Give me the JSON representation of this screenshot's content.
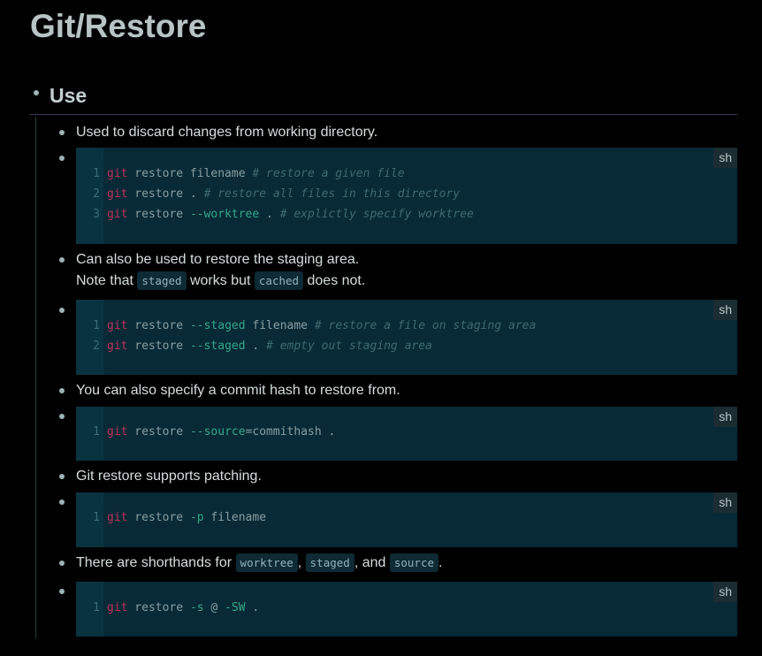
{
  "page_title": "Git/Restore",
  "section_title": "Use",
  "items": [
    {
      "text": "Used to discard changes from working directory."
    },
    {
      "lang": "sh",
      "lines": [
        {
          "n": "1",
          "parts": [
            [
              "kw",
              "git"
            ],
            [
              "tx",
              " restore filename "
            ],
            [
              "cm",
              "# restore a given file"
            ]
          ]
        },
        {
          "n": "2",
          "parts": [
            [
              "kw",
              "git"
            ],
            [
              "tx",
              " restore . "
            ],
            [
              "cm",
              "# restore all files in this directory"
            ]
          ]
        },
        {
          "n": "3",
          "parts": [
            [
              "kw",
              "git"
            ],
            [
              "tx",
              " restore "
            ],
            [
              "fl",
              "--worktree"
            ],
            [
              "tx",
              " . "
            ],
            [
              "cm",
              "# explictly specify worktree"
            ]
          ]
        }
      ]
    },
    {
      "text": "Can also be used to restore the staging area."
    },
    {
      "note": {
        "pre": "Note that ",
        "code1": "staged",
        "mid": " works but ",
        "code2": "cached",
        "post": " does not."
      }
    },
    {
      "lang": "sh",
      "lines": [
        {
          "n": "1",
          "parts": [
            [
              "kw",
              "git"
            ],
            [
              "tx",
              " restore "
            ],
            [
              "fl",
              "--staged"
            ],
            [
              "tx",
              " filename "
            ],
            [
              "cm",
              "# restore a file on staging area"
            ]
          ]
        },
        {
          "n": "2",
          "parts": [
            [
              "kw",
              "git"
            ],
            [
              "tx",
              " restore "
            ],
            [
              "fl",
              "--staged"
            ],
            [
              "tx",
              " . "
            ],
            [
              "cm",
              "# empty out staging area"
            ]
          ]
        }
      ]
    },
    {
      "text": "You can also specify a commit hash to restore from."
    },
    {
      "lang": "sh",
      "lines": [
        {
          "n": "1",
          "parts": [
            [
              "kw",
              "git"
            ],
            [
              "tx",
              " restore "
            ],
            [
              "fl",
              "--source"
            ],
            [
              "tx",
              "=commithash ."
            ]
          ]
        }
      ]
    },
    {
      "text": "Git restore supports patching."
    },
    {
      "lang": "sh",
      "lines": [
        {
          "n": "1",
          "parts": [
            [
              "kw",
              "git"
            ],
            [
              "tx",
              " restore "
            ],
            [
              "fl",
              "-p"
            ],
            [
              "tx",
              " filename"
            ]
          ]
        }
      ]
    },
    {
      "shorthand": {
        "pre": "There are shorthands for ",
        "c1": "worktree",
        "s1": ", ",
        "c2": "staged",
        "s2": ", and ",
        "c3": "source",
        "post": "."
      }
    },
    {
      "lang": "sh",
      "lines": [
        {
          "n": "1",
          "parts": [
            [
              "kw",
              "git"
            ],
            [
              "tx",
              " restore "
            ],
            [
              "fl",
              "-s"
            ],
            [
              "tx",
              " @ "
            ],
            [
              "fl",
              "-SW"
            ],
            [
              "tx",
              " ."
            ]
          ]
        }
      ]
    }
  ]
}
